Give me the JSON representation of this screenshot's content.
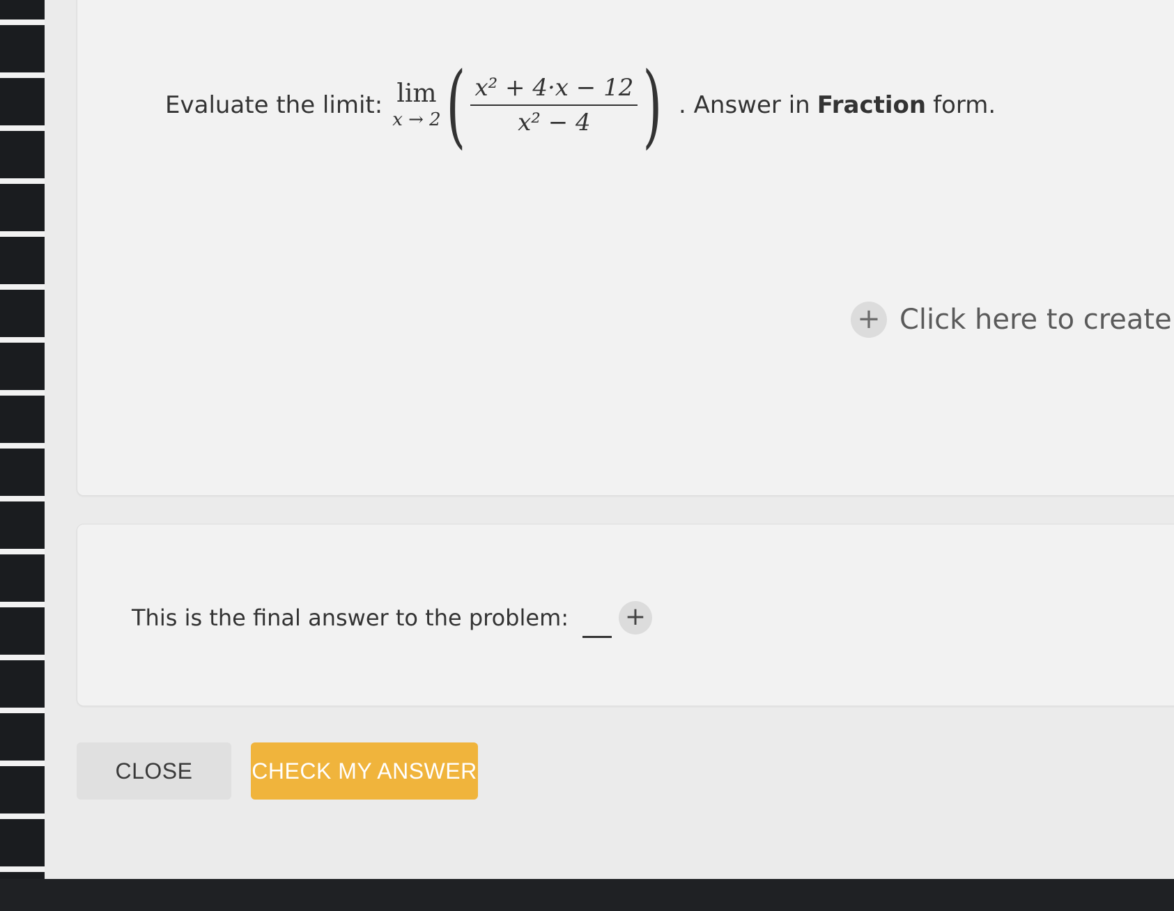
{
  "question": {
    "prefix": "Evaluate the limit:",
    "lim_word": "lim",
    "lim_sub": "x → 2",
    "numerator": "x² + 4·x − 12",
    "denominator": "x² − 4",
    "suffix_pre": ". Answer in",
    "suffix_bold": "Fraction",
    "suffix_post": "form."
  },
  "create_step": {
    "icon": "+",
    "label": "Click here to create a ne"
  },
  "answer": {
    "label": "This is the final answer to the problem:",
    "value": "",
    "add_icon": "+"
  },
  "buttons": {
    "close": "CLOSE",
    "check": "CHECK MY ANSWER"
  },
  "colors": {
    "accent": "#f0b43c",
    "card": "#f2f2f2",
    "background": "#ebebeb"
  }
}
